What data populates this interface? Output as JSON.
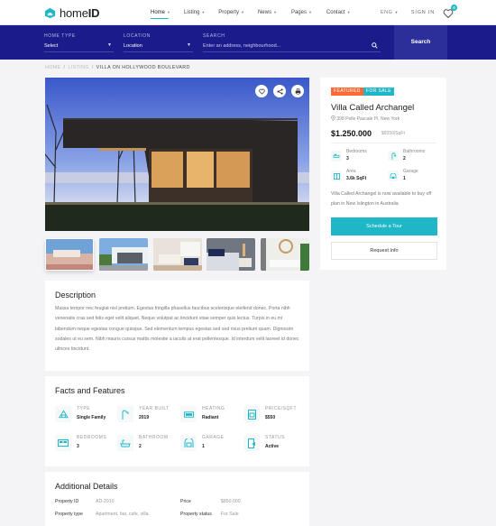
{
  "brand": {
    "name_light": "home",
    "name_bold": "ID",
    "accent": "#1fb7c7",
    "navy": "#1b1b8c"
  },
  "nav": {
    "items": [
      {
        "label": "Home",
        "active": true
      },
      {
        "label": "Listing",
        "active": false
      },
      {
        "label": "Property",
        "active": false
      },
      {
        "label": "News",
        "active": false
      },
      {
        "label": "Pages",
        "active": false
      },
      {
        "label": "Contact",
        "active": false
      }
    ],
    "language": "ENG",
    "sign_in": "SIGN IN",
    "wishlist_count": "0"
  },
  "search": {
    "home_type": {
      "label": "HOME TYPE",
      "value": "Select"
    },
    "location": {
      "label": "LOCATION",
      "value": "Location"
    },
    "keyword": {
      "label": "SEARCH",
      "placeholder": "Enter an address, neighbourhood..."
    },
    "button": "Search"
  },
  "breadcrumb": [
    "HOME",
    "LISTING",
    "VILLA ON HOLLYWOOD BOULEVARD"
  ],
  "gallery": {
    "actions": [
      "favorite",
      "share",
      "print"
    ],
    "thumbnails": [
      "exterior-terrace",
      "modern-house",
      "living-room",
      "bedroom",
      "bathroom"
    ]
  },
  "listing": {
    "badges": [
      {
        "label": "FEATURED",
        "color": "#ff6935"
      },
      {
        "label": "FOR SALE",
        "color": "#1fb7c7"
      }
    ],
    "title": "Villa Called Archangel",
    "address": "398 Pelle Pascale Pl, New York",
    "price": "$1.250.000",
    "price_per_sqft": "$9350/SqFt",
    "specs": [
      {
        "label": "Bedrooms",
        "value": "3",
        "icon": "bed-icon"
      },
      {
        "label": "Bathrooms",
        "value": "2",
        "icon": "shower-icon"
      },
      {
        "label": "Area",
        "value": "3.6k SqFt",
        "icon": "area-icon"
      },
      {
        "label": "Garage",
        "value": "1",
        "icon": "garage-icon"
      }
    ],
    "summary": "Villa Called Archangel is now available to buy off plan in New Islington in Australia",
    "schedule_button": "Schedule a Tour",
    "request_button": "Request Info"
  },
  "description": {
    "title": "Description",
    "text": "Massa tempor nec feugiat nisl pretium. Egestas fringilla phasellus faucibus scelerisque eleifend donec. Porta nibh venenatis cras sed felis eget velit aliquet. Neque volutpat ac tincidunt vitae semper quis lectus. Turpis in eu mi bibendum neque egestas congue quisque. Sed elementum tempus egestas sed sed risus pretium quam. Dignissim sodales ut eu sem. Nibh mauris cursus mattis molestie a iaculis at erat pellentesque. Id interdum velit laoreet id donec ultrices tincidunt."
  },
  "facts": {
    "title": "Facts and Features",
    "items": [
      {
        "label": "TYPE",
        "value": "Single Family",
        "icon": "house-icon"
      },
      {
        "label": "YEAR BUILT",
        "value": "2019",
        "icon": "faucet-icon"
      },
      {
        "label": "HEATING",
        "value": "Radiant",
        "icon": "radiator-icon"
      },
      {
        "label": "PRICE/SQFT",
        "value": "$550",
        "icon": "price-tag-icon"
      },
      {
        "label": "BEDROOMS",
        "value": "3",
        "icon": "bed-icon"
      },
      {
        "label": "BATHROOM",
        "value": "2",
        "icon": "bathtub-icon"
      },
      {
        "label": "GARAGE",
        "value": "1",
        "icon": "garage-icon"
      },
      {
        "label": "STATUS",
        "value": "Active",
        "icon": "status-icon"
      }
    ]
  },
  "additional": {
    "title": "Additional Details",
    "rows": [
      {
        "key": "Property ID",
        "value": "AD-2910"
      },
      {
        "key": "Price",
        "value": "$850.000"
      },
      {
        "key": "Property type",
        "value": "Apartment, bar, cafe, villa"
      },
      {
        "key": "Property status",
        "value": "For Sale"
      }
    ]
  }
}
